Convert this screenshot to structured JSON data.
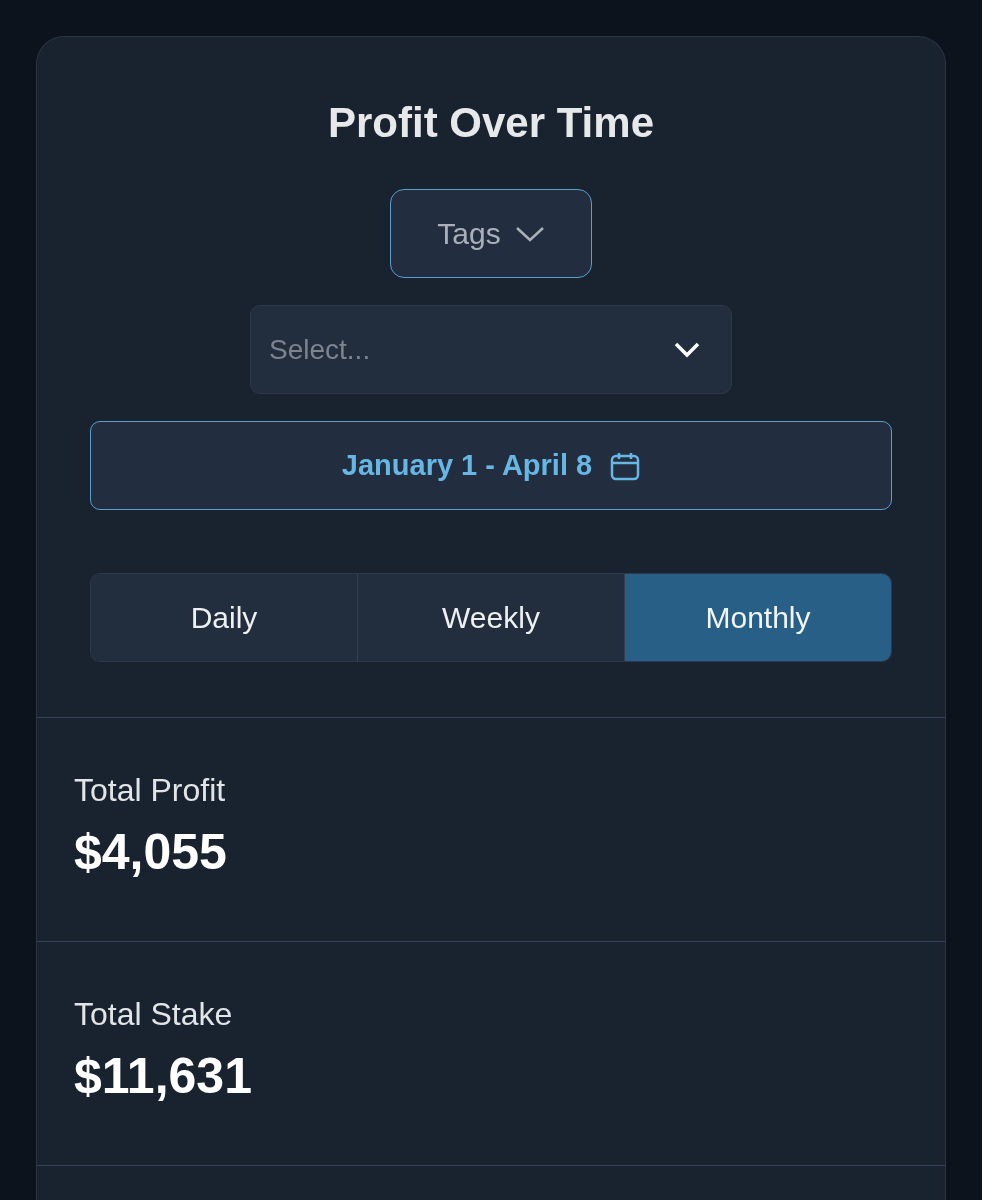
{
  "title": "Profit Over Time",
  "tags_button": {
    "label": "Tags"
  },
  "select": {
    "placeholder": "Select..."
  },
  "date_range": {
    "label": "January 1 - April 8"
  },
  "periods": [
    {
      "label": "Daily",
      "selected": false
    },
    {
      "label": "Weekly",
      "selected": false
    },
    {
      "label": "Monthly",
      "selected": true
    }
  ],
  "stats": [
    {
      "label": "Total Profit",
      "value": "$4,055"
    },
    {
      "label": "Total Stake",
      "value": "$11,631"
    }
  ]
}
